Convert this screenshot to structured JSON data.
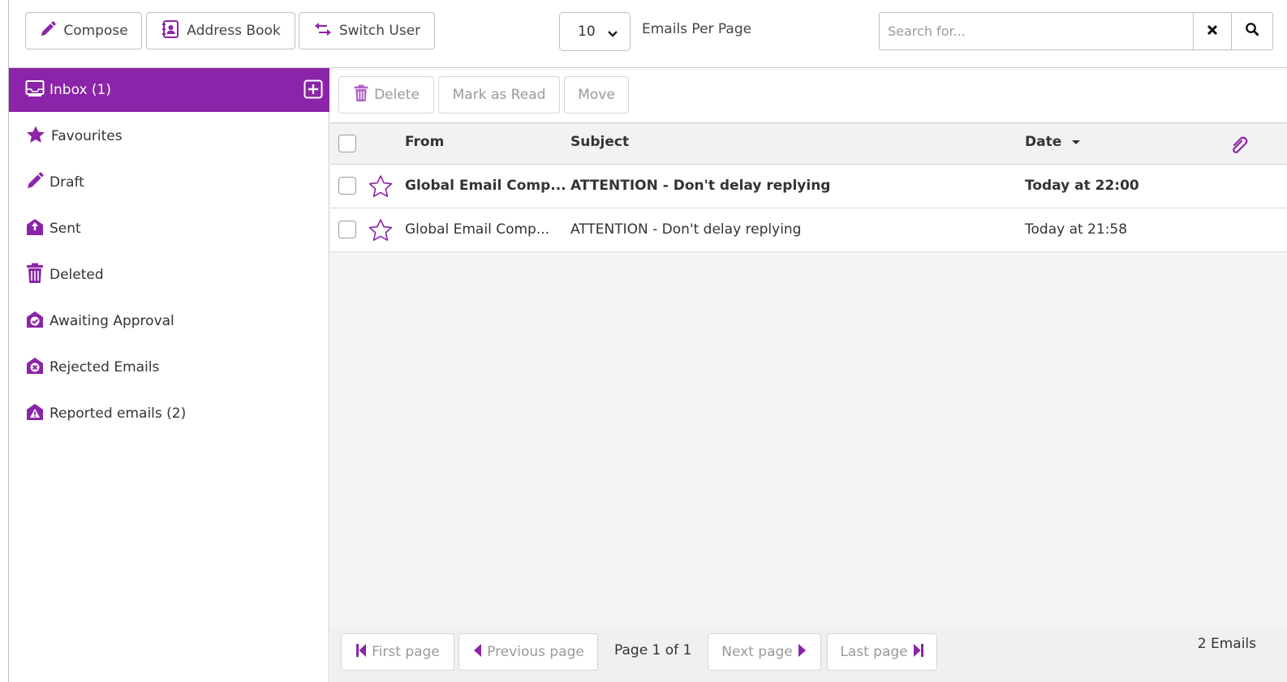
{
  "colors": {
    "accent": "#8b24a8",
    "active_text": "#ffffff",
    "disabled_text": "#9a9a9a",
    "list_bg": "#f4f4f4"
  },
  "toolbar": {
    "compose_label": "Compose",
    "address_book_label": "Address Book",
    "switch_user_label": "Switch User",
    "per_page_value": "10",
    "per_page_label": "Emails Per Page",
    "search_placeholder": "Search for..."
  },
  "sidebar": {
    "items": [
      {
        "label": "Inbox (1)",
        "icon": "inbox-icon",
        "active": true
      },
      {
        "label": "Favourites",
        "icon": "star-icon"
      },
      {
        "label": "Draft",
        "icon": "pencil-icon"
      },
      {
        "label": "Sent",
        "icon": "sent-icon"
      },
      {
        "label": "Deleted",
        "icon": "trash-icon"
      },
      {
        "label": "Awaiting Approval",
        "icon": "approval-icon"
      },
      {
        "label": "Rejected Emails",
        "icon": "rejected-icon"
      },
      {
        "label": "Reported emails (2)",
        "icon": "reported-icon"
      }
    ]
  },
  "actions": {
    "delete_label": "Delete",
    "mark_read_label": "Mark as Read",
    "move_label": "Move"
  },
  "list": {
    "headers": {
      "from": "From",
      "subject": "Subject",
      "date": "Date"
    },
    "rows": [
      {
        "from": "Global Email Comp...",
        "subject": "ATTENTION - Don't delay replying",
        "date": "Today at 22:00",
        "unread": true
      },
      {
        "from": "Global Email Comp...",
        "subject": "ATTENTION - Don't delay replying",
        "date": "Today at 21:58",
        "unread": false
      }
    ]
  },
  "pager": {
    "first_label": "First page",
    "prev_label": "Previous page",
    "page_info": "Page 1 of 1",
    "next_label": "Next page",
    "last_label": "Last page",
    "count": "2 Emails"
  }
}
